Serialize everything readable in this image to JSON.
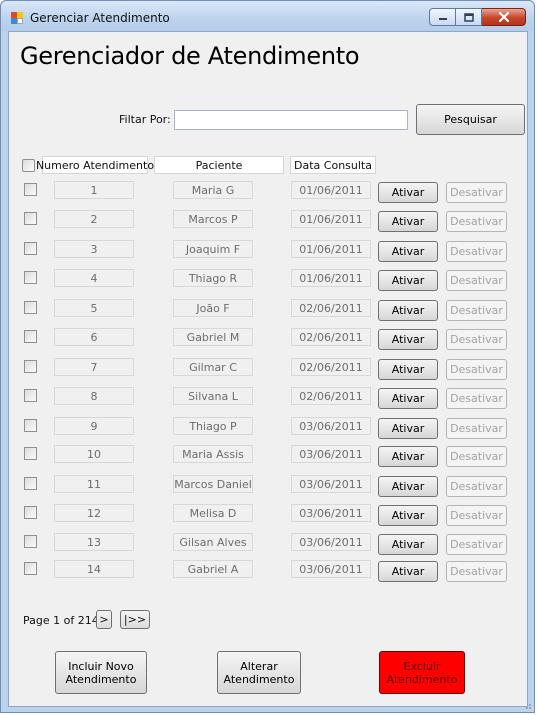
{
  "window": {
    "title": "Gerenciar Atendimento",
    "controls": {
      "minimize_icon": "minimize-icon",
      "maximize_icon": "maximize-icon",
      "close_icon": "close-icon"
    }
  },
  "page_title": "Gerenciador de Atendimento",
  "filter": {
    "label": "Filtar Por:",
    "value": "",
    "placeholder": "",
    "search_button": "Pesquisar"
  },
  "grid": {
    "headers": [
      "Numero Atendimento",
      "Paciente",
      "Data Consulta"
    ],
    "activate_label": "Ativar",
    "deactivate_label": "Desativar",
    "rows": [
      {
        "numero": "1",
        "paciente": "Maria G",
        "data": "01/06/2011"
      },
      {
        "numero": "2",
        "paciente": "Marcos P",
        "data": "01/06/2011"
      },
      {
        "numero": "3",
        "paciente": "Joaquim F",
        "data": "01/06/2011"
      },
      {
        "numero": "4",
        "paciente": "Thiago R",
        "data": "01/06/2011"
      },
      {
        "numero": "5",
        "paciente": "João F",
        "data": "02/06/2011"
      },
      {
        "numero": "6",
        "paciente": "Gabriel M",
        "data": "02/06/2011"
      },
      {
        "numero": "7",
        "paciente": "Gilmar C",
        "data": "02/06/2011"
      },
      {
        "numero": "8",
        "paciente": "Silvana L",
        "data": "02/06/2011"
      },
      {
        "numero": "9",
        "paciente": "Thiago P",
        "data": "03/06/2011"
      },
      {
        "numero": "10",
        "paciente": "Maria Assis",
        "data": "03/06/2011"
      },
      {
        "numero": "11",
        "paciente": "Marcos Daniel",
        "data": "03/06/2011"
      },
      {
        "numero": "12",
        "paciente": "Melisa D",
        "data": "03/06/2011"
      },
      {
        "numero": "13",
        "paciente": "Gilsan Alves",
        "data": "03/06/2011"
      },
      {
        "numero": "14",
        "paciente": "Gabriel A",
        "data": "03/06/2011"
      }
    ]
  },
  "pager": {
    "text": "Page 1 of 214",
    "next_label": ">",
    "last_label": "|>>"
  },
  "actions": {
    "include": "Incluir Novo Atendimento",
    "alter": "Alterar Atendimento",
    "delete": "Excluir Atendimento"
  },
  "colors": {
    "delete_button": "#ff0000",
    "titlebar": "#bcd3ee",
    "client_bg": "#f0f0f0",
    "close_button": "#c7442a"
  }
}
